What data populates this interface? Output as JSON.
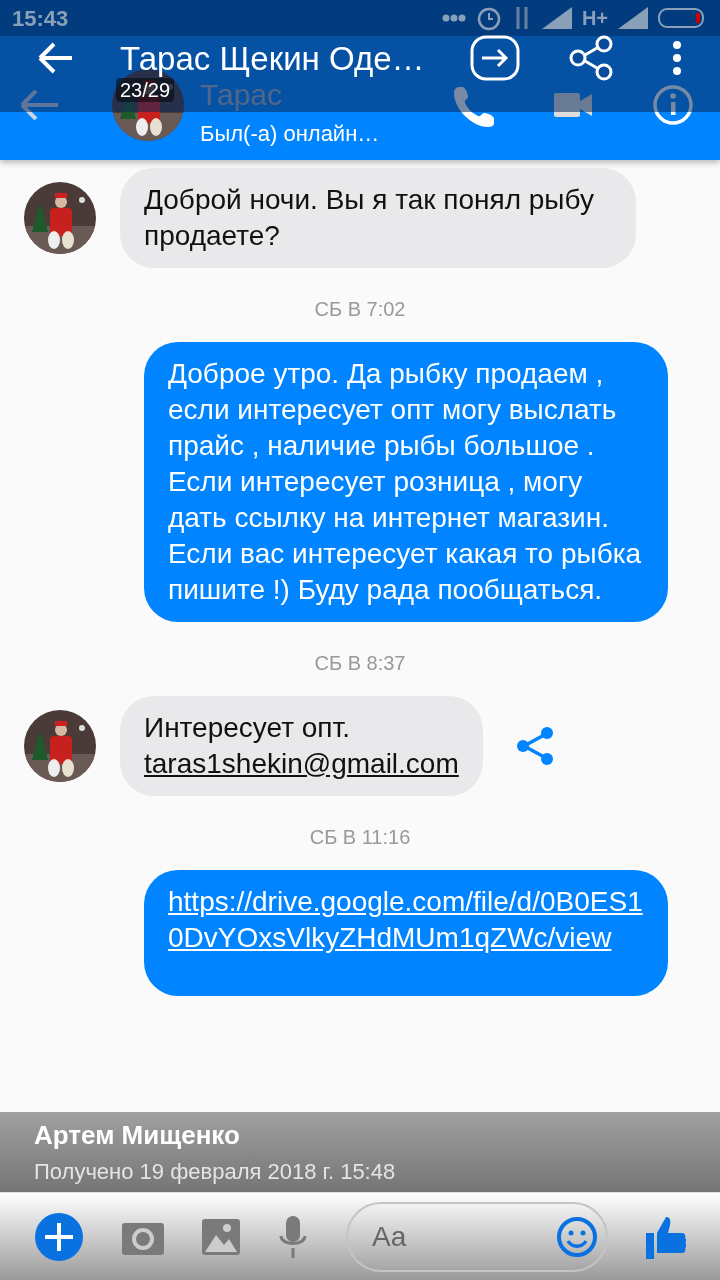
{
  "status_bar": {
    "time": "15:43",
    "network": "H+"
  },
  "viewer": {
    "title": "Тарас Щекин Оде…",
    "counter": "23/29",
    "caption": {
      "sender": "Артем Мищенко",
      "received": "Получено 19 февраля 2018 г. 15:48"
    }
  },
  "chat_header": {
    "name": "Тарас",
    "status": "Был(-а) онлайн…"
  },
  "messages": [
    {
      "kind": "incoming",
      "text": "Доброй ночи. Вы я так понял рыбу продаете?"
    },
    {
      "kind": "timestamp",
      "text": "СБ В 7:02"
    },
    {
      "kind": "outgoing",
      "text": "Доброе утро. Да рыбку продаем , если интересует опт могу выслать прайс , наличие рыбы большое . Если интересует розница , могу дать ссылку на интернет магазин. Если вас интересует какая то рыбка пишите !) Буду рада пообщаться."
    },
    {
      "kind": "timestamp",
      "text": "СБ В 8:37"
    },
    {
      "kind": "incoming",
      "text": "Интересует опт.",
      "link": "taras1shekin@gmail.com",
      "share": true
    },
    {
      "kind": "timestamp",
      "text": "СБ В 11:16"
    },
    {
      "kind": "outgoing",
      "link": "https://drive.google.com/file/d/0B0ES10DvYOxsVlkyZHdMUm1qZWc/view"
    }
  ],
  "composer": {
    "placeholder": "Aa"
  }
}
